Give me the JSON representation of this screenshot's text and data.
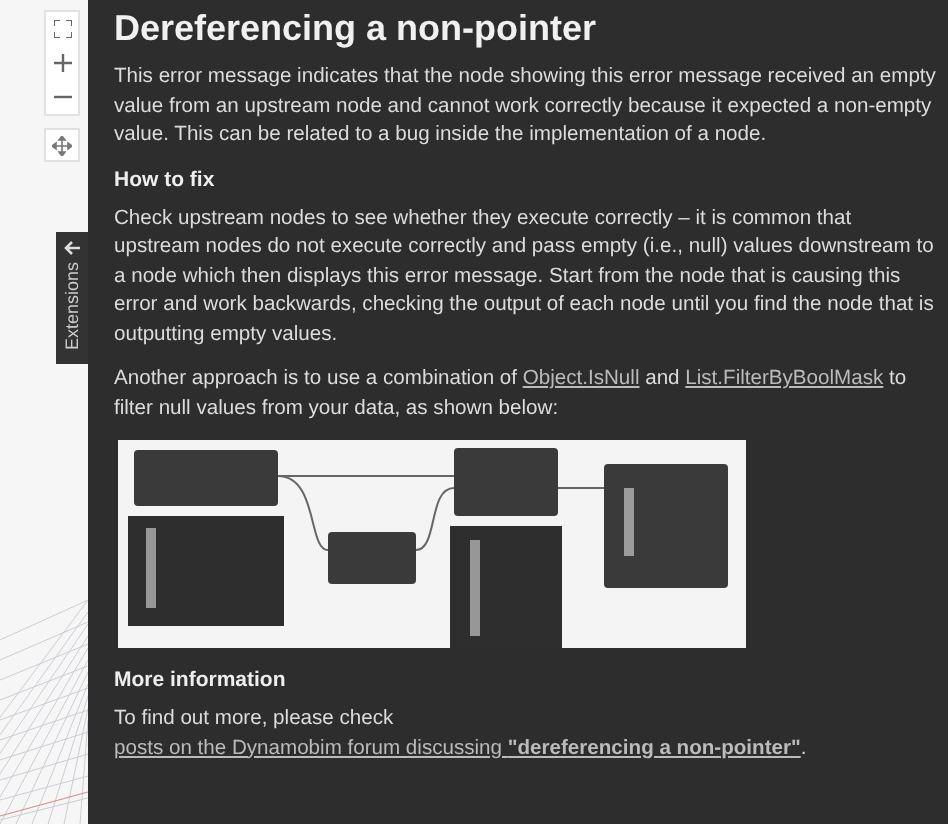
{
  "canvas_toolbar": {
    "buttons": [
      {
        "kind": "fit"
      },
      {
        "kind": "zoom-in"
      },
      {
        "kind": "zoom-out"
      }
    ],
    "pan_button": {
      "kind": "pan"
    }
  },
  "extensions_tab": {
    "label": "Extensions"
  },
  "article": {
    "title": "Dereferencing a non-pointer",
    "blocks": [
      {
        "kind": "paragraph",
        "parts": [
          {
            "kind": "text",
            "text": "This error message indicates that the node showing this error message received an empty value from an upstream node and cannot work correctly because it expected a non-empty value. This can be related to a bug inside the implementation of a node."
          }
        ]
      },
      {
        "kind": "heading",
        "text": "How to fix"
      },
      {
        "kind": "paragraph",
        "parts": [
          {
            "kind": "text",
            "text": "Check upstream nodes to see whether they execute correctly – it is common that upstream nodes do not execute correctly and pass empty (i.e., null) values downstream to a node which then displays this error message. Start from the node that is causing this error and work backwards, checking the output of each node until you find the node that is outputting empty values."
          }
        ]
      },
      {
        "kind": "paragraph",
        "parts": [
          {
            "kind": "text",
            "text": "Another approach is to use a combination of "
          },
          {
            "kind": "link",
            "text": "Object.IsNull"
          },
          {
            "kind": "text",
            "text": " and "
          },
          {
            "kind": "link",
            "text": "List.FilterByBoolMask"
          },
          {
            "kind": "text",
            "text": " to filter null values from your data, as shown below:"
          }
        ]
      },
      {
        "kind": "picture"
      },
      {
        "kind": "heading",
        "text": "More information"
      },
      {
        "kind": "paragraph",
        "parts": [
          {
            "kind": "text",
            "text": "To find out more, please check "
          },
          {
            "kind": "link",
            "text": "posts on the Dynamobim forum discussing **\"dereferencing a non-pointer\"**"
          },
          {
            "kind": "text",
            "text": "."
          }
        ]
      }
    ]
  }
}
